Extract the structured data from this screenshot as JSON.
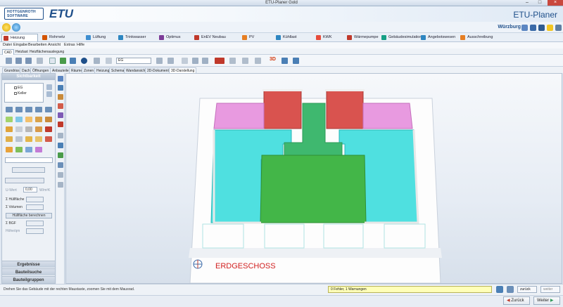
{
  "window": {
    "title": "ETU-Planer Gold",
    "app_name": "ETU-Planer"
  },
  "logo": {
    "line1": "HOTTGENROTH",
    "line2": "SOFTWARE",
    "brand": "ETU"
  },
  "location": "Würzburg",
  "module_tabs": [
    {
      "label": "Heizung",
      "color": "#c0392b"
    },
    {
      "label": "Rohrnetz",
      "color": "#d35400"
    },
    {
      "label": "Lüftung",
      "color": "#3e8ed0"
    },
    {
      "label": "Trinkwasser",
      "color": "#2e86c1"
    },
    {
      "label": "Optimus",
      "color": "#7d3c98"
    },
    {
      "label": "EnEV Neubau",
      "color": "#c0392b"
    },
    {
      "label": "PV",
      "color": "#e67e22"
    },
    {
      "label": "Kühllast",
      "color": "#2e86c1"
    },
    {
      "label": "KWK",
      "color": "#e74c3c"
    },
    {
      "label": "Wärmepumpe",
      "color": "#c0392b"
    },
    {
      "label": "Gebäudesimulation",
      "color": "#16a085"
    },
    {
      "label": "Angebotswesen",
      "color": "#2e86c1"
    },
    {
      "label": "Ausschreibung",
      "color": "#e67e22"
    }
  ],
  "menu": [
    "Datei",
    "Eingabe",
    "Bearbeiten",
    "Ansicht",
    "Extras",
    "Hilfe"
  ],
  "sub_tabs": [
    "CAD",
    "Heizlast",
    "Heizflächenauslegung"
  ],
  "toolbar": {
    "layer_value": "EG",
    "badge_3d": "3D"
  },
  "view_tabs": [
    "Grundriss",
    "Dach",
    "Öffnungen",
    "Anbauteile",
    "Räume",
    "Zonen",
    "Heizung",
    "Schema",
    "Wandansicht",
    "2D-Dokumente",
    "3D-Darstellung"
  ],
  "left_panel": {
    "title": "Sichtbarkeit",
    "floors": [
      "EG",
      "Keller"
    ],
    "u_wert_label": "U-Wert",
    "u_wert_value": "0,00",
    "u_wert_unit": "W/m²K",
    "hullflaeche_label": "Hüllfläche",
    "volumen_label": "Volumen",
    "calc_button": "Hüllfläche berechnen",
    "bgf_label": "BGF",
    "hoehe_label": "Höhe/qm",
    "sections": [
      "Ergebnisse",
      "Bauteilsuche",
      "Bauteilgruppen"
    ]
  },
  "view3d": {
    "floor_label": "ERDGESCHOSS"
  },
  "status": {
    "hint": "Drehen Sie das Gebäude mit der rechten Maustaste, zoomen Sie mit dem Mausrad.",
    "warnings": "0 Fehler, 1 Warnungen",
    "back_small": "zurück",
    "next_small": "weiter"
  },
  "nav": {
    "back": "Zurück",
    "next": "Weiter"
  }
}
